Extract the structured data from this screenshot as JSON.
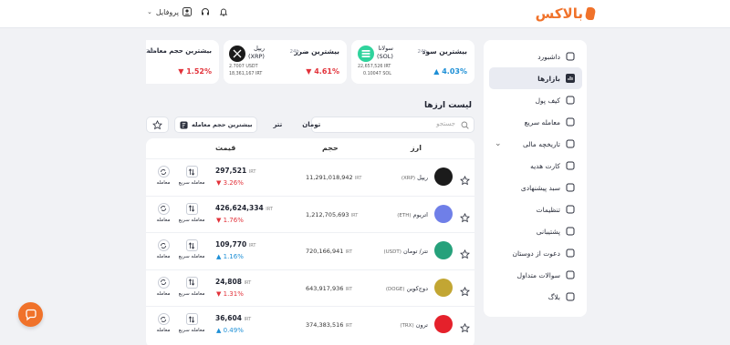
{
  "header": {
    "logo_text": "بالاکس",
    "profile_label": "پروفایل"
  },
  "sidebar": {
    "items": [
      {
        "label": "داشبورد",
        "icon": "dashboard-icon"
      },
      {
        "label": "بازارها",
        "icon": "markets-icon",
        "active": true
      },
      {
        "label": "کیف پول",
        "icon": "wallet-icon"
      },
      {
        "label": "معامله سریع",
        "icon": "swap-icon"
      },
      {
        "label": "تاریخچه مالی",
        "icon": "history-icon",
        "chevron": true
      },
      {
        "label": "کارت هدیه",
        "icon": "gift-card-icon"
      },
      {
        "label": "سبد پیشنهادی",
        "icon": "basket-icon"
      },
      {
        "label": "تنظیمات",
        "icon": "settings-icon"
      },
      {
        "label": "پشتیبانی",
        "icon": "headset-icon"
      },
      {
        "label": "دعوت از دوستان",
        "icon": "invite-icon"
      },
      {
        "label": "سوالات متداول",
        "icon": "faq-icon"
      },
      {
        "label": "بلاگ",
        "icon": "blog-icon"
      }
    ]
  },
  "cards": {
    "profit": {
      "title": "بیشترین سود",
      "period": "24h",
      "coin_fa": "سولانا",
      "coin_sym": "(SOL)",
      "price": "22,657,526",
      "price_unit": "IRT",
      "usdt": "0.10047",
      "usdt_unit": "SOL",
      "pct": "4.03%"
    },
    "loss": {
      "title": "بیشترین ضرر",
      "period": "24h",
      "coin_fa": "ریپل",
      "coin_sym": "(XRP)",
      "price": "2.7007",
      "price_unit": "USDT",
      "usdt": "18,361,167",
      "usdt_unit": "IRT",
      "pct": "4.61%"
    },
    "volume": {
      "title": "بیشترین حجم معامله",
      "period": "24h",
      "pct": "1.52%"
    }
  },
  "market": {
    "title": "لیست ارزها",
    "search_placeholder": "جستجو",
    "filter_toman": "تومان",
    "filter_tether": "تتر",
    "filter_volume": "بیشترین حجم معامله",
    "col_coin": "ارز",
    "col_volume": "حجم",
    "col_price": "قیمت",
    "quick_trade": "معامله سریع",
    "trade": "معامله",
    "unit": "IRT",
    "rows": [
      {
        "name": "ریپل",
        "sym": "(XRP)",
        "volume": "11,291,018,942",
        "price": "297,521",
        "change": "3.26%",
        "dir": "down",
        "icon": "xrp-icon",
        "color": "#1b1b1b"
      },
      {
        "name": "اتریوم",
        "sym": "(ETH)",
        "volume": "1,212,705,693",
        "price": "426,624,334",
        "change": "1.76%",
        "dir": "down",
        "icon": "eth-icon",
        "color": "#6f7fe8"
      },
      {
        "name": "تتر/ تومان",
        "sym": "(USDT)",
        "volume": "720,166,941",
        "price": "109,770",
        "change": "1.16%",
        "dir": "up",
        "icon": "usdt-icon",
        "color": "#26a17b"
      },
      {
        "name": "دوج‌کوین",
        "sym": "(DOGE)",
        "volume": "643,917,936",
        "price": "24,808",
        "change": "1.31%",
        "dir": "down",
        "icon": "doge-icon",
        "color": "#c2a633"
      },
      {
        "name": "ترون",
        "sym": "(TRX)",
        "volume": "374,383,516",
        "price": "36,604",
        "change": "0.49%",
        "dir": "up",
        "icon": "trx-icon",
        "color": "#e5212b"
      }
    ]
  },
  "colors": {
    "accent": "#f0722a",
    "up": "#1d8fd6",
    "down": "#e2323a"
  }
}
